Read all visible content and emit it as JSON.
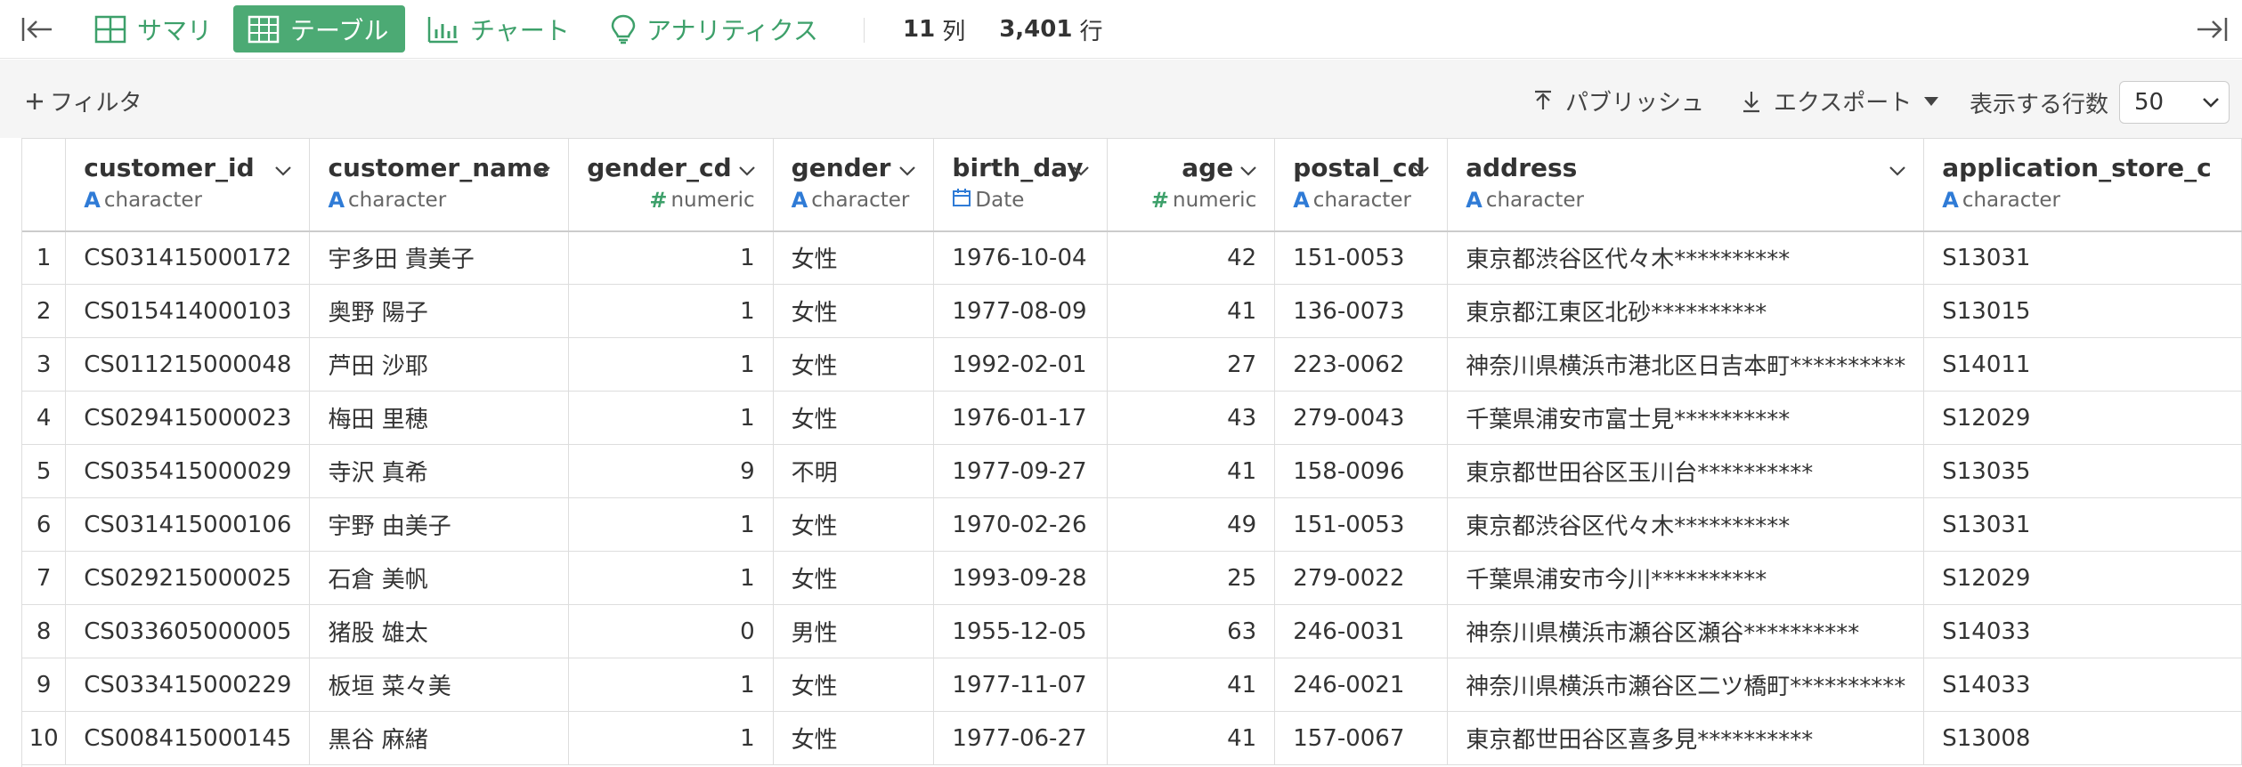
{
  "toolbar": {
    "tabs": [
      {
        "label": "サマリ",
        "icon": "summary-grid-icon"
      },
      {
        "label": "テーブル",
        "icon": "table-icon",
        "active": true
      },
      {
        "label": "チャート",
        "icon": "bar-chart-icon"
      },
      {
        "label": "アナリティクス",
        "icon": "lightbulb-icon"
      }
    ],
    "column_count": "11",
    "column_unit": "列",
    "row_count": "3,401",
    "row_unit": "行"
  },
  "subbar": {
    "filter_label": "フィルタ",
    "publish_label": "パブリッシュ",
    "export_label": "エクスポート",
    "rows_label": "表示する行数",
    "rows_value": "50"
  },
  "colors": {
    "accent": "#4caa74",
    "type_character": "#2f7bd6",
    "type_numeric": "#3da06a"
  },
  "columns": [
    {
      "name": "customer_id",
      "type": "character"
    },
    {
      "name": "customer_name",
      "type": "character"
    },
    {
      "name": "gender_cd",
      "type": "numeric"
    },
    {
      "name": "gender",
      "type": "character"
    },
    {
      "name": "birth_day",
      "type": "Date"
    },
    {
      "name": "age",
      "type": "numeric"
    },
    {
      "name": "postal_cd",
      "type": "character"
    },
    {
      "name": "address",
      "type": "character"
    },
    {
      "name": "application_store_c",
      "type": "character"
    }
  ],
  "rows": [
    [
      "1",
      "CS031415000172",
      "宇多田 貴美子",
      "1",
      "女性",
      "1976-10-04",
      "42",
      "151-0053",
      "東京都渋谷区代々木**********",
      "S13031"
    ],
    [
      "2",
      "CS015414000103",
      "奥野 陽子",
      "1",
      "女性",
      "1977-08-09",
      "41",
      "136-0073",
      "東京都江東区北砂**********",
      "S13015"
    ],
    [
      "3",
      "CS011215000048",
      "芦田 沙耶",
      "1",
      "女性",
      "1992-02-01",
      "27",
      "223-0062",
      "神奈川県横浜市港北区日吉本町**********",
      "S14011"
    ],
    [
      "4",
      "CS029415000023",
      "梅田 里穂",
      "1",
      "女性",
      "1976-01-17",
      "43",
      "279-0043",
      "千葉県浦安市富士見**********",
      "S12029"
    ],
    [
      "5",
      "CS035415000029",
      "寺沢 真希",
      "9",
      "不明",
      "1977-09-27",
      "41",
      "158-0096",
      "東京都世田谷区玉川台**********",
      "S13035"
    ],
    [
      "6",
      "CS031415000106",
      "宇野 由美子",
      "1",
      "女性",
      "1970-02-26",
      "49",
      "151-0053",
      "東京都渋谷区代々木**********",
      "S13031"
    ],
    [
      "7",
      "CS029215000025",
      "石倉 美帆",
      "1",
      "女性",
      "1993-09-28",
      "25",
      "279-0022",
      "千葉県浦安市今川**********",
      "S12029"
    ],
    [
      "8",
      "CS033605000005",
      "猪股 雄太",
      "0",
      "男性",
      "1955-12-05",
      "63",
      "246-0031",
      "神奈川県横浜市瀬谷区瀬谷**********",
      "S14033"
    ],
    [
      "9",
      "CS033415000229",
      "板垣 菜々美",
      "1",
      "女性",
      "1977-11-07",
      "41",
      "246-0021",
      "神奈川県横浜市瀬谷区二ツ橋町**********",
      "S14033"
    ],
    [
      "10",
      "CS008415000145",
      "黒谷 麻緒",
      "1",
      "女性",
      "1977-06-27",
      "41",
      "157-0067",
      "東京都世田谷区喜多見**********",
      "S13008"
    ]
  ]
}
